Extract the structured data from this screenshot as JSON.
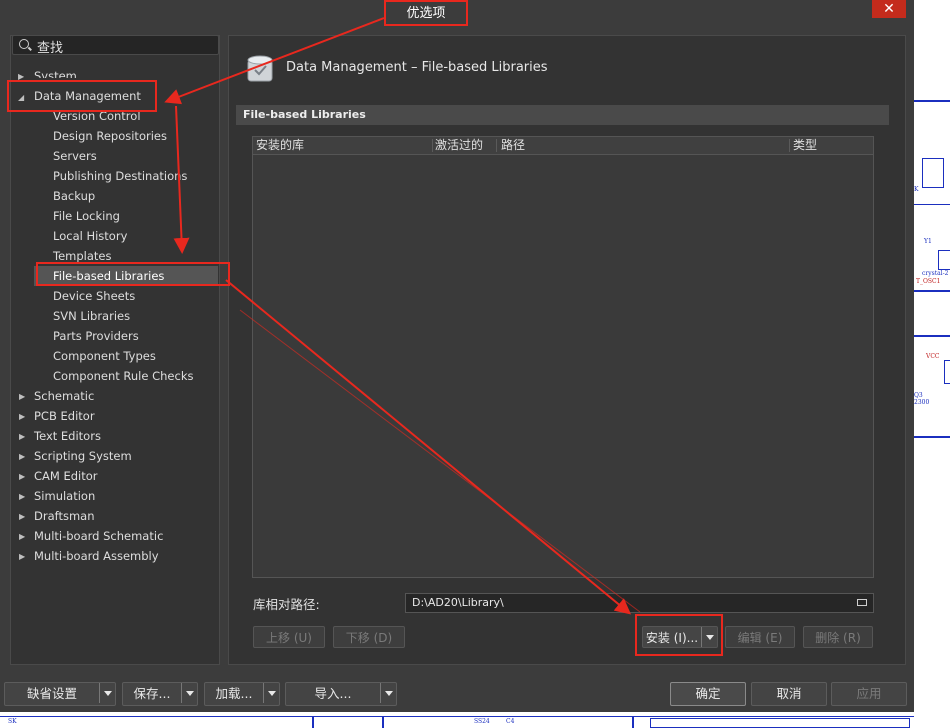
{
  "window": {
    "title": "优选项"
  },
  "search": {
    "placeholder": "查找"
  },
  "tree": {
    "system": "System",
    "data_management": "Data Management",
    "children": [
      "Version Control",
      "Design Repositories",
      "Servers",
      "Publishing Destinations",
      "Backup",
      "File Locking",
      "Local History",
      "Templates",
      "File-based Libraries",
      "Device Sheets",
      "SVN Libraries",
      "Parts Providers",
      "Component Types",
      "Component Rule Checks"
    ],
    "groups": [
      "Schematic",
      "PCB Editor",
      "Text Editors",
      "Scripting System",
      "CAM Editor",
      "Simulation",
      "Draftsman",
      "Multi-board Schematic",
      "Multi-board Assembly"
    ]
  },
  "main": {
    "page_title": "Data Management – File-based Libraries",
    "section_title": "File-based Libraries",
    "columns": [
      "安装的库",
      "激活过的",
      "路径",
      "类型"
    ],
    "relative_path_label": "库相对路径:",
    "relative_path_value": "D:\\AD20\\Library\\",
    "buttons": {
      "move_up": "上移 (U)",
      "move_down": "下移 (D)",
      "install": "安装 (I)...",
      "edit": "编辑 (E)",
      "remove": "删除 (R)"
    }
  },
  "footer": {
    "defaults": "缺省设置",
    "save": "保存...",
    "load": "加载...",
    "import": "导入...",
    "ok": "确定",
    "cancel": "取消",
    "apply": "应用"
  },
  "schematic": {
    "labels": [
      "K",
      "Y1",
      "crystal-2",
      "T_OSC1",
      "VCC",
      "Q3",
      "2300",
      "SK",
      "SS24",
      "C4"
    ]
  },
  "colors": {
    "highlight": "#e8281e",
    "dialog_bg": "#3c3c3c",
    "panel_bg": "#333333"
  }
}
